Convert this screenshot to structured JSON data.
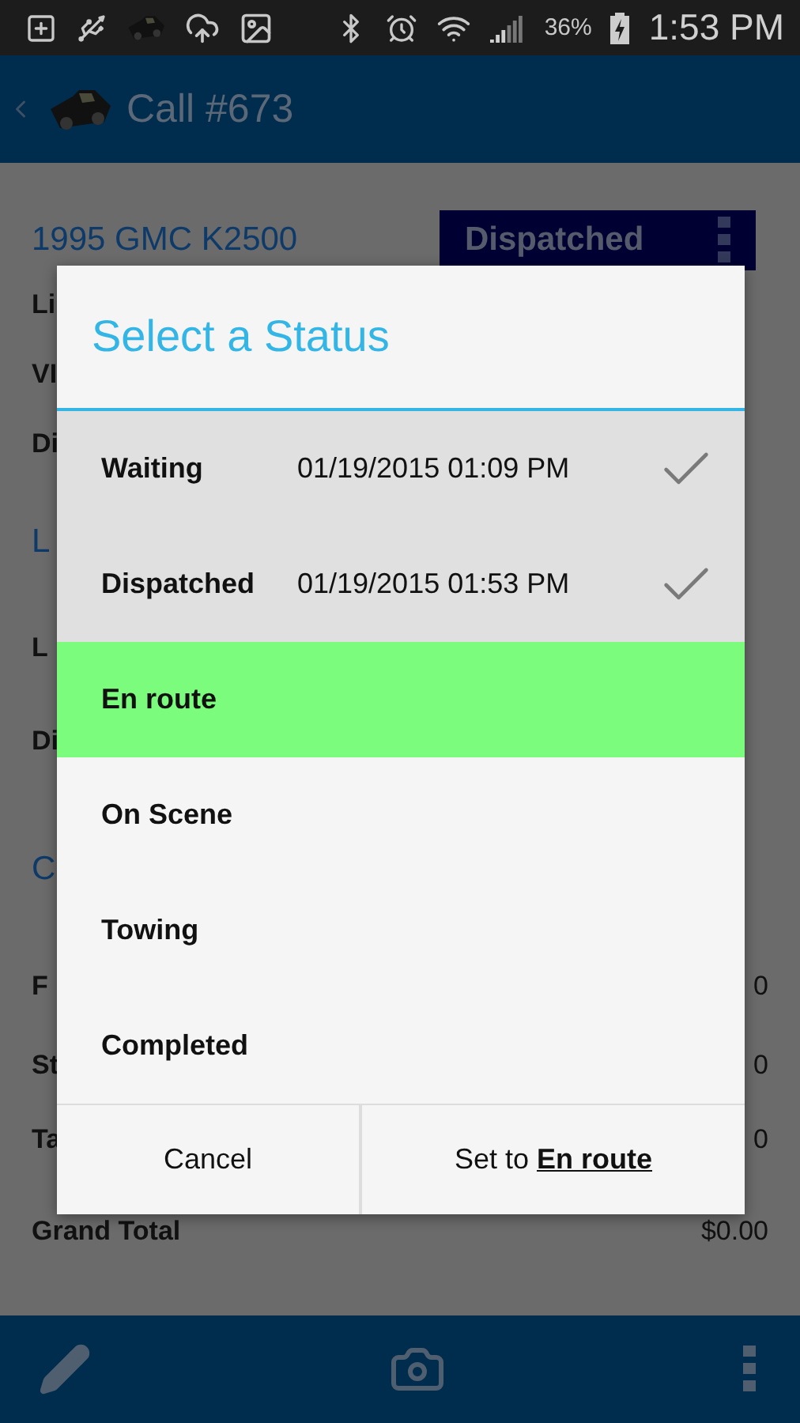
{
  "status_bar": {
    "battery": "36%",
    "time": "1:53 PM"
  },
  "action_bar": {
    "title": "Call #673"
  },
  "vehicle": {
    "title": "1995 GMC K2500",
    "status": "Dispatched"
  },
  "background_rows": [
    {
      "kind": "label",
      "label": "Li"
    },
    {
      "kind": "label",
      "label": "VI"
    },
    {
      "kind": "label",
      "label": "Di"
    },
    {
      "kind": "heading",
      "label": "L"
    },
    {
      "kind": "label",
      "label": "L"
    },
    {
      "kind": "label",
      "label": "Di"
    },
    {
      "kind": "heading",
      "label": "C"
    },
    {
      "kind": "label",
      "label": "F",
      "value": "0"
    },
    {
      "kind": "label",
      "label": "St",
      "value": "0"
    },
    {
      "kind": "label",
      "label": "Ta",
      "value": "0"
    },
    {
      "kind": "label",
      "label": "Grand Total",
      "value": "$0.00"
    }
  ],
  "dialog": {
    "title": "Select a Status",
    "statuses": [
      {
        "name": "Waiting",
        "time": "01/19/2015 01:09 PM",
        "done": true,
        "selected": false
      },
      {
        "name": "Dispatched",
        "time": "01/19/2015 01:53 PM",
        "done": true,
        "selected": false
      },
      {
        "name": "En route",
        "done": false,
        "selected": true
      },
      {
        "name": "On Scene",
        "done": false,
        "selected": false
      },
      {
        "name": "Towing",
        "done": false,
        "selected": false
      },
      {
        "name": "Completed",
        "done": false,
        "selected": false
      }
    ],
    "buttons": [
      "Cancel",
      "Set to **En route**"
    ]
  }
}
